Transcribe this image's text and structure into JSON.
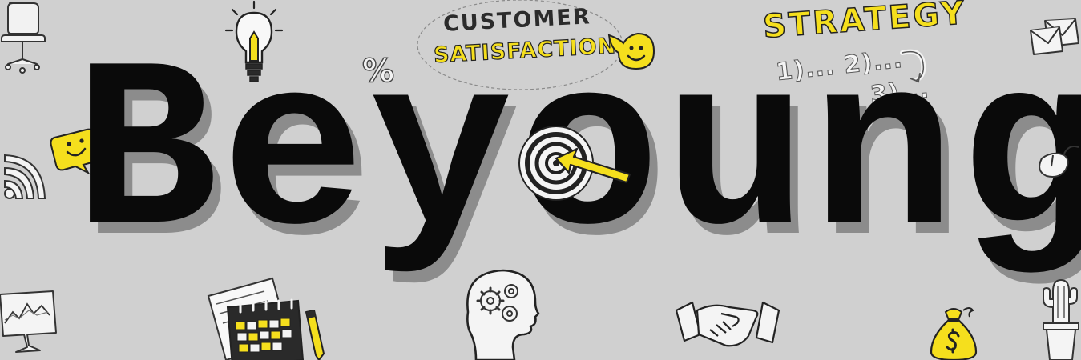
{
  "brand": {
    "word": "Beyoung"
  },
  "doodles": {
    "customer_line1": "CUSTOMER",
    "customer_line2": "SATISFACTION",
    "strategy_title": "STRATEGY",
    "strategy_steps_1": "1)... 2)...",
    "strategy_steps_2": "3)...",
    "percent_symbol": "%"
  },
  "colors": {
    "background": "#d0d0d0",
    "accent_yellow": "#f5df1d",
    "ink": "#0a0a0a",
    "shadow": "#8c8c8c"
  },
  "icons": [
    "office-chair-icon",
    "lightbulb-icon",
    "smiley-icon",
    "speech-bubble-smiley-icon",
    "wifi-signal-icon",
    "target-icon",
    "arrow-icon",
    "envelope-icon",
    "computer-mouse-icon",
    "monitor-chart-icon",
    "calendar-icon",
    "pencil-icon",
    "head-gears-icon",
    "handshake-icon",
    "money-bag-icon",
    "cactus-icon"
  ]
}
